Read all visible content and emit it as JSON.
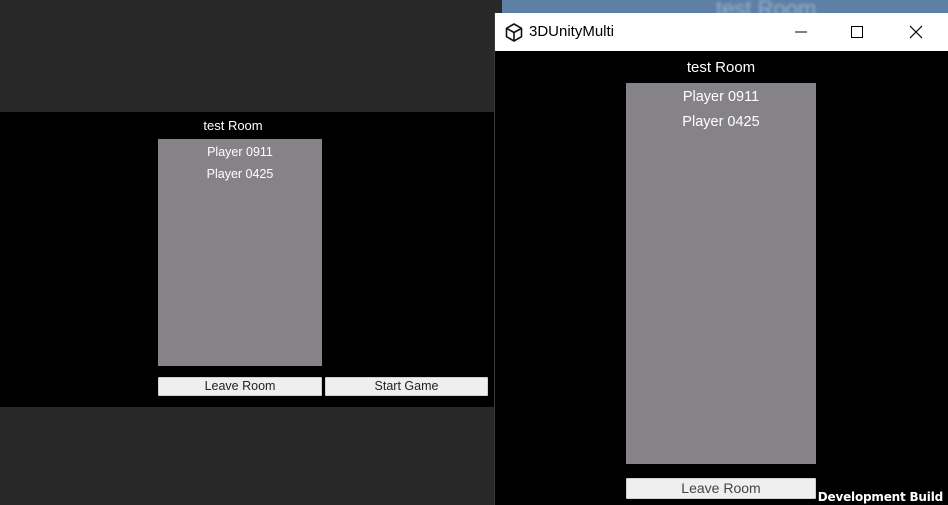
{
  "editor_view": {
    "room_title": "test Room",
    "players": [
      "Player 0911",
      "Player 0425"
    ],
    "leave_label": "Leave Room",
    "start_label": "Start Game"
  },
  "background_blurred_text": "test Room",
  "window": {
    "app_title": "3DUnityMulti",
    "app_icon": "unity-logo-icon",
    "controls": [
      "minimize-icon",
      "maximize-icon",
      "close-icon"
    ],
    "room_title": "test Room",
    "players": [
      "Player 0911",
      "Player 0425"
    ],
    "leave_label": "Leave Room",
    "dev_build_label": "Development Build"
  },
  "colors": {
    "panel_bg": "#858288",
    "game_bg": "#000000",
    "editor_bg": "#282828",
    "button_bg": "#efefef"
  }
}
